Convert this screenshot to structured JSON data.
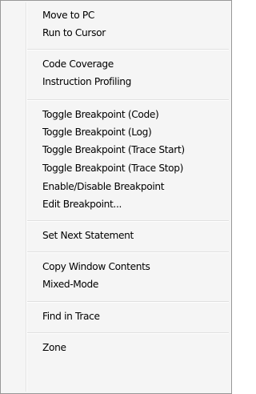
{
  "menu": {
    "move_to_pc": "Move to PC",
    "run_to_cursor": "Run to Cursor",
    "code_coverage": "Code Coverage",
    "instruction_profiling": "Instruction Profiling",
    "toggle_bp_code": "Toggle Breakpoint (Code)",
    "toggle_bp_log": "Toggle Breakpoint (Log)",
    "toggle_bp_trace_start": "Toggle Breakpoint (Trace Start)",
    "toggle_bp_trace_stop": "Toggle Breakpoint (Trace Stop)",
    "enable_disable_bp": "Enable/Disable Breakpoint",
    "edit_bp": "Edit Breakpoint...",
    "set_next_statement": "Set Next Statement",
    "copy_window_contents": "Copy Window Contents",
    "mixed_mode": "Mixed-Mode",
    "find_in_trace": "Find in Trace",
    "zone": "Zone"
  }
}
